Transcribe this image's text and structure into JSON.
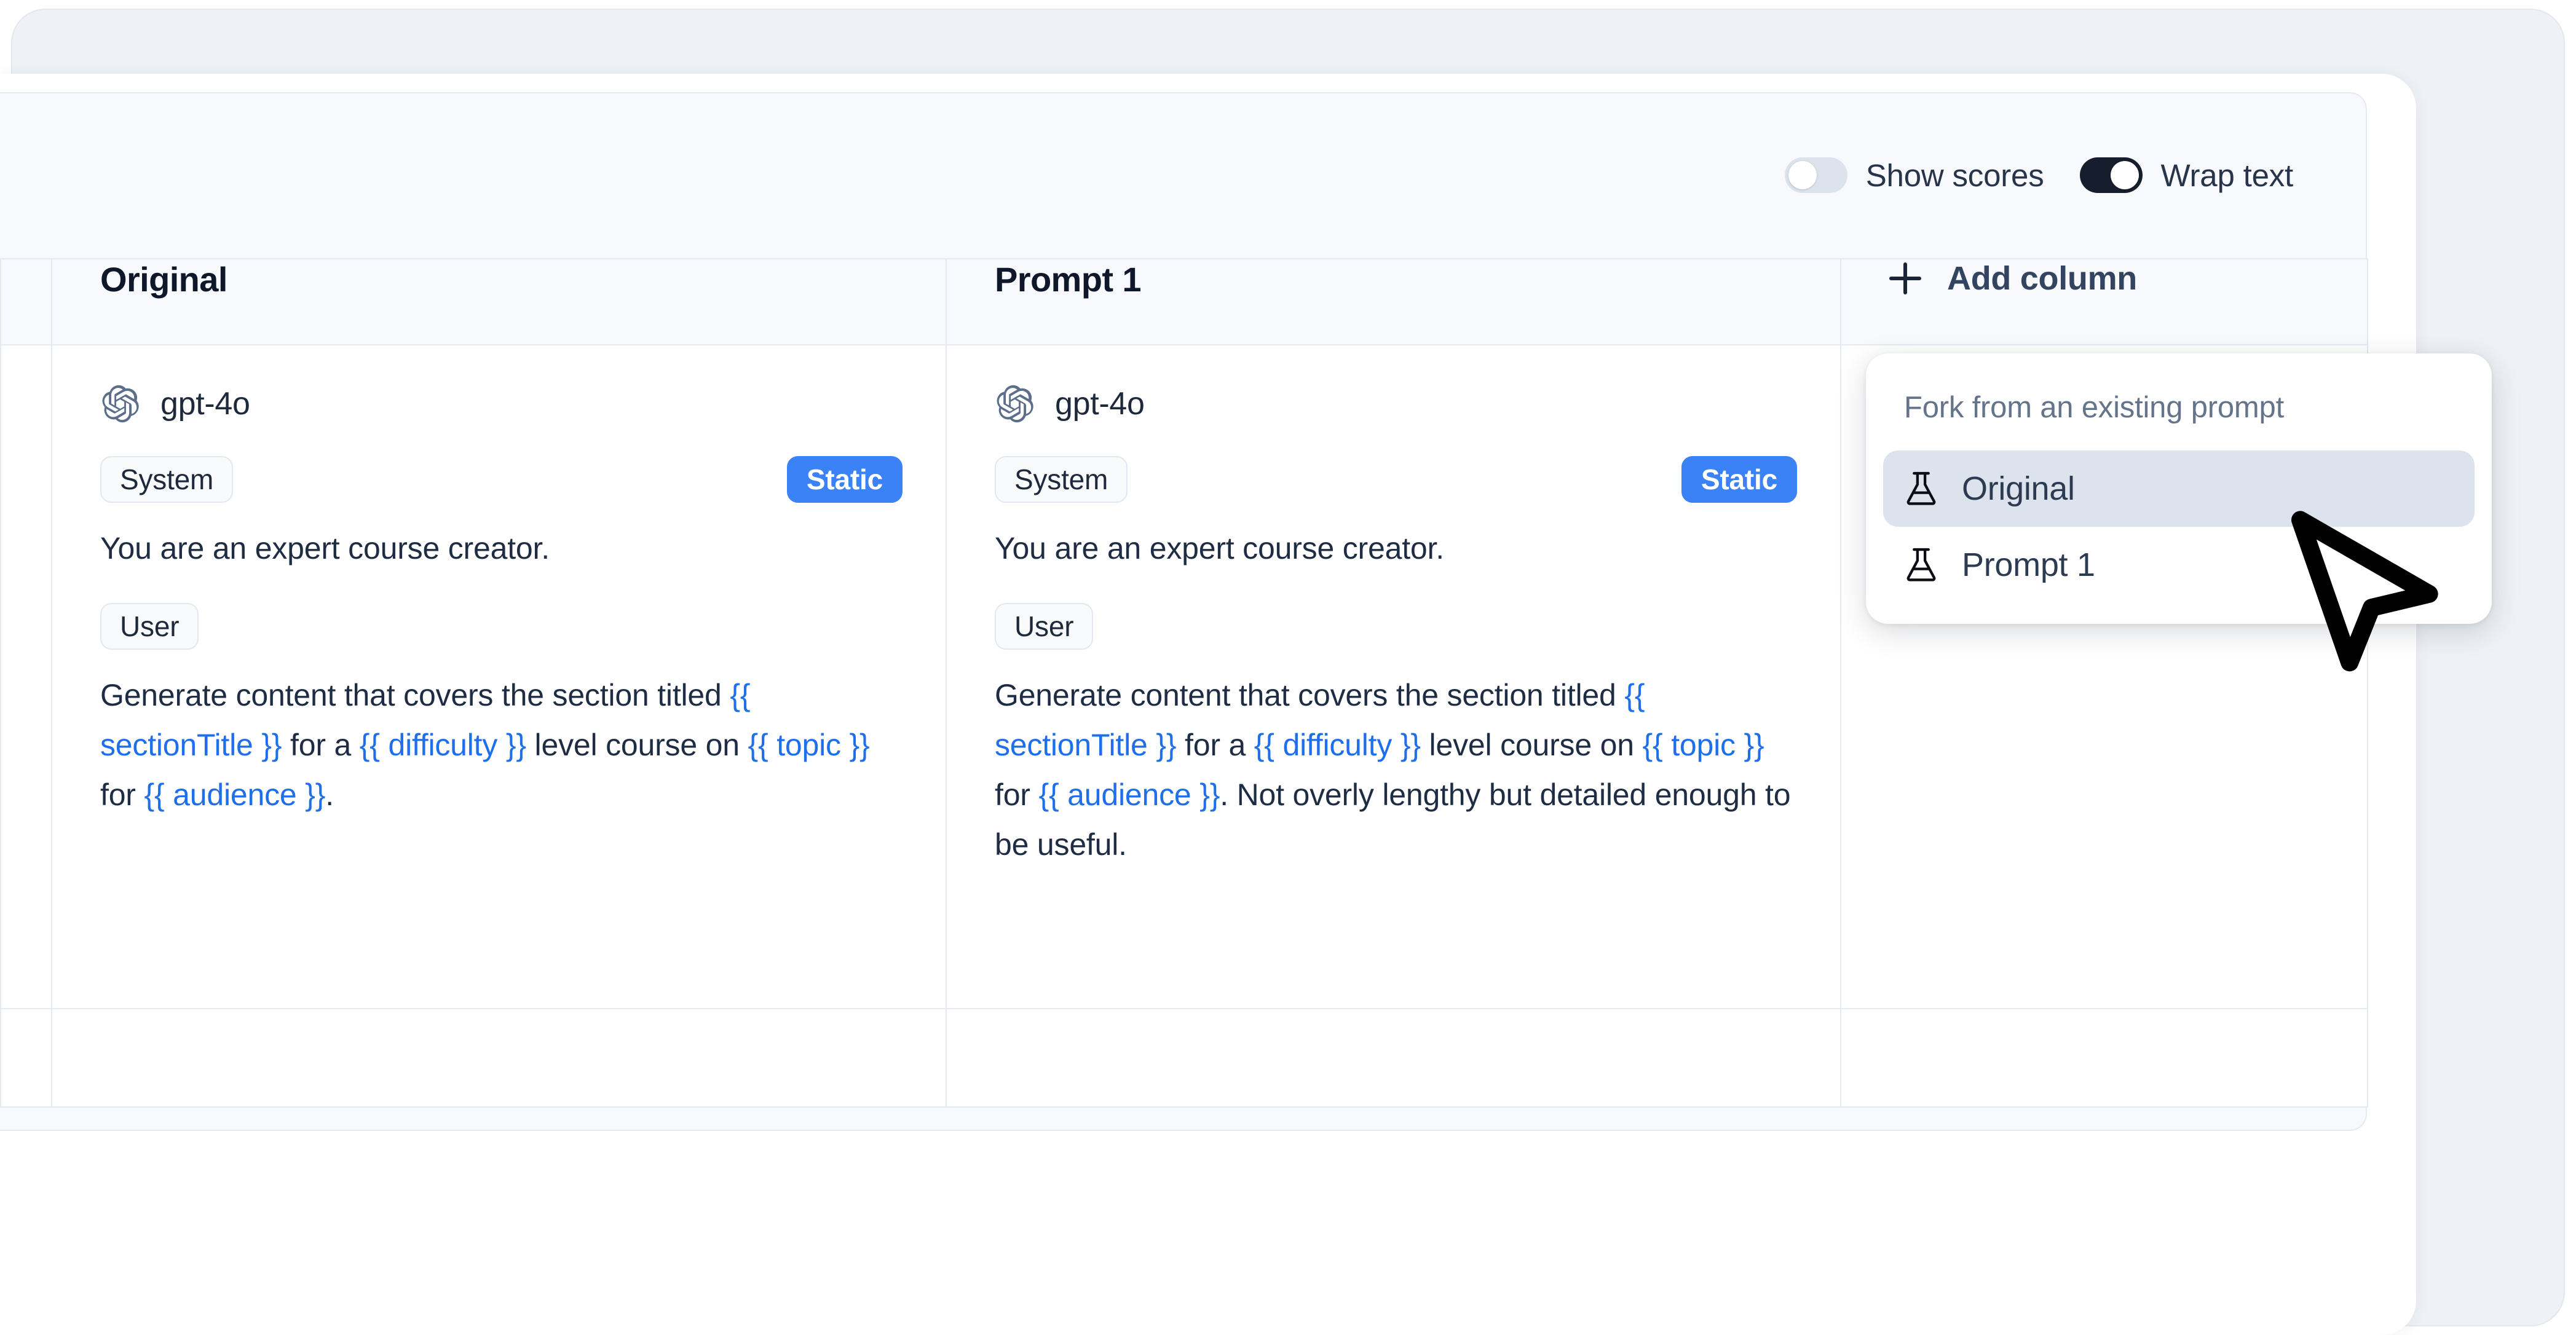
{
  "toolbar": {
    "toggles": [
      {
        "label": "Show scores",
        "state": "off",
        "icon": "toggle-switch-icon"
      },
      {
        "label": "Wrap text",
        "state": "on",
        "icon": "toggle-switch-icon"
      }
    ]
  },
  "table": {
    "headers": {
      "gutter": "",
      "original": "Original",
      "prompt1": "Prompt 1",
      "add_column": "Add column",
      "add_column_icon": "plus-icon"
    },
    "columns": [
      {
        "id": "original",
        "model": "gpt-4o",
        "model_icon": "openai-logo-icon",
        "messages": [
          {
            "role_badge": "System",
            "type_badge": "Static",
            "text_parts": [
              {
                "t": "You are an expert course creator.",
                "kind": "plain"
              }
            ]
          },
          {
            "role_badge": "User",
            "type_badge": "",
            "text_parts": [
              {
                "t": "Generate content that covers the section titled ",
                "kind": "plain"
              },
              {
                "t": "{{ sectionTitle }}",
                "kind": "var"
              },
              {
                "t": " for a ",
                "kind": "plain"
              },
              {
                "t": "{{ difficulty }}",
                "kind": "var"
              },
              {
                "t": " level course on ",
                "kind": "plain"
              },
              {
                "t": "{{ topic }}",
                "kind": "var"
              },
              {
                "t": " for ",
                "kind": "plain"
              },
              {
                "t": "{{ audience }}",
                "kind": "var"
              },
              {
                "t": ".",
                "kind": "plain"
              }
            ]
          }
        ]
      },
      {
        "id": "prompt1",
        "model": "gpt-4o",
        "model_icon": "openai-logo-icon",
        "messages": [
          {
            "role_badge": "System",
            "type_badge": "Static",
            "text_parts": [
              {
                "t": "You are an expert course creator.",
                "kind": "plain"
              }
            ]
          },
          {
            "role_badge": "User",
            "type_badge": "",
            "text_parts": [
              {
                "t": "Generate content that covers the section titled ",
                "kind": "plain"
              },
              {
                "t": "{{ sectionTitle }}",
                "kind": "var"
              },
              {
                "t": " for a ",
                "kind": "plain"
              },
              {
                "t": "{{ difficulty }}",
                "kind": "var"
              },
              {
                "t": " level course on ",
                "kind": "plain"
              },
              {
                "t": "{{ topic }}",
                "kind": "var"
              },
              {
                "t": " for ",
                "kind": "plain"
              },
              {
                "t": "{{ audience }}",
                "kind": "var"
              },
              {
                "t": ". Not overly lengthy but detailed enough to be useful.",
                "kind": "plain"
              }
            ]
          }
        ]
      }
    ]
  },
  "dropdown": {
    "title": "Fork from an existing prompt",
    "items": [
      {
        "label": "Original",
        "icon": "flask-icon",
        "highlighted": true
      },
      {
        "label": "Prompt 1",
        "icon": "flask-icon",
        "highlighted": false
      }
    ]
  },
  "cursor": {
    "icon": "mouse-pointer-icon"
  },
  "colors": {
    "accent_blue": "#3b82f6",
    "variable_blue": "#1f6feb",
    "toggle_on": "#161e2e",
    "toggle_off": "#dde3ec",
    "text_primary": "#1e2d44",
    "text_muted": "#64748b",
    "panel_bg": "#f7f9fc",
    "outer_bg": "#eef1f5",
    "border": "#e5e9f0",
    "highlight_bg": "#dde3ec"
  }
}
